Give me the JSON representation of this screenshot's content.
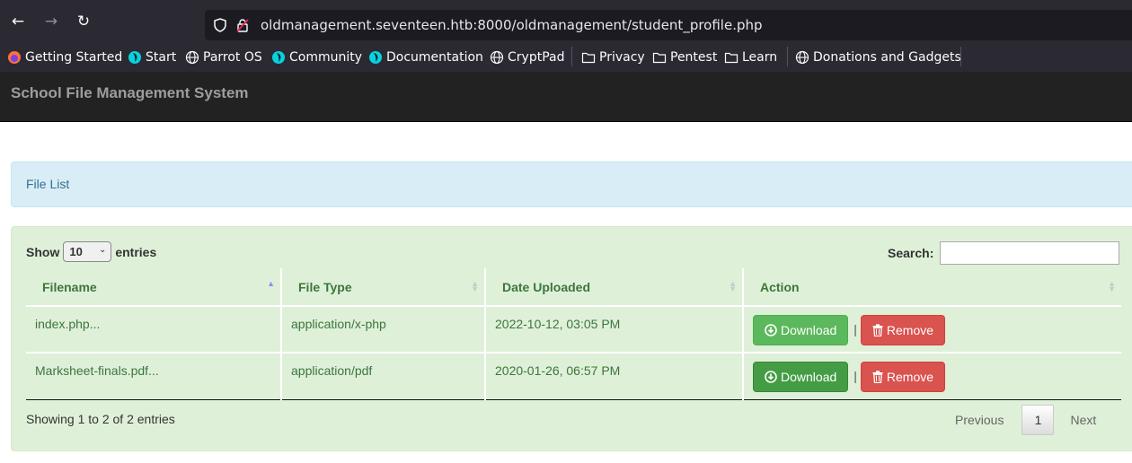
{
  "browser": {
    "url": "oldmanagement.seventeen.htb:8000/oldmanagement/student_profile.php",
    "bookmarks": [
      {
        "label": "Getting Started",
        "icon": "firefox-icon"
      },
      {
        "label": "Start",
        "icon": "parrot-icon"
      },
      {
        "label": "Parrot OS",
        "icon": "globe-icon"
      },
      {
        "label": "Community",
        "icon": "parrot-icon"
      },
      {
        "label": "Documentation",
        "icon": "parrot-icon"
      },
      {
        "label": "CryptPad",
        "icon": "globe-icon"
      },
      {
        "label": "Privacy",
        "icon": "folder-icon"
      },
      {
        "label": "Pentest",
        "icon": "folder-icon"
      },
      {
        "label": "Learn",
        "icon": "folder-icon"
      },
      {
        "label": "Donations and Gadgets",
        "icon": "globe-icon"
      }
    ]
  },
  "app": {
    "brand": "School File Management System",
    "panel_title": "File List",
    "length": {
      "show_label": "Show",
      "value": "10",
      "entries_label": "entries"
    },
    "search_label": "Search:",
    "columns": [
      "Filename",
      "File Type",
      "Date Uploaded",
      "Action"
    ],
    "rows": [
      {
        "filename": "index.php...",
        "filetype": "application/x-php",
        "date": "2022-10-12, 03:05 PM"
      },
      {
        "filename": "Marksheet-finals.pdf...",
        "filetype": "application/pdf",
        "date": "2020-01-26, 06:57 PM"
      }
    ],
    "download_label": "Download",
    "remove_label": "Remove",
    "separator": "|",
    "info": "Showing 1 to 2 of 2 entries",
    "pagination": {
      "previous": "Previous",
      "current": "1",
      "next": "Next"
    }
  },
  "colors": {
    "chrome": "#2b2a33",
    "navbar": "#222222",
    "panel_info": "#d9edf7",
    "panel_success": "#dff0d8",
    "btn_success": "#5cb85c",
    "btn_danger": "#d9534f"
  }
}
